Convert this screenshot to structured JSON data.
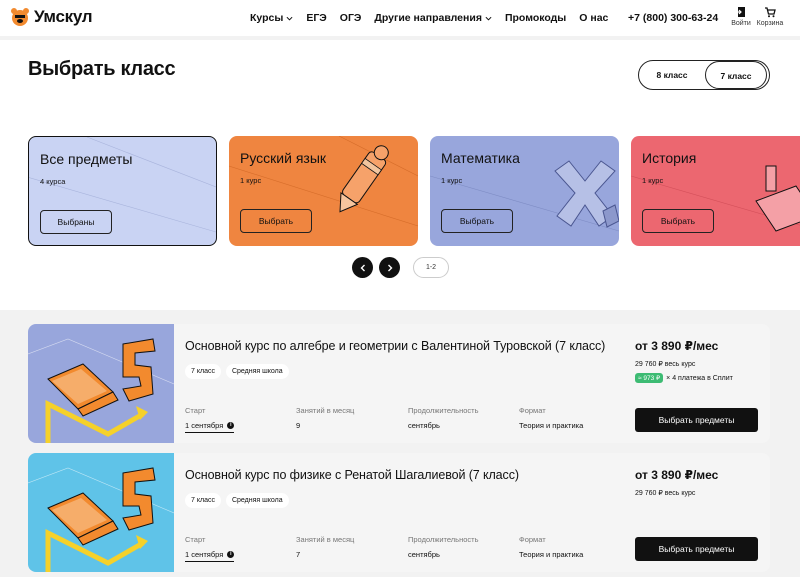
{
  "header": {
    "logo_text": "Умскул",
    "nav": [
      {
        "label": "Курсы",
        "dropdown": true
      },
      {
        "label": "ЕГЭ",
        "dropdown": false
      },
      {
        "label": "ОГЭ",
        "dropdown": false
      },
      {
        "label": "Другие направления",
        "dropdown": true
      },
      {
        "label": "Промокоды",
        "dropdown": false
      },
      {
        "label": "О нас",
        "dropdown": false
      }
    ],
    "phone": "+7 (800) 300-63-24",
    "login_label": "Войти",
    "cart_label": "Корзина"
  },
  "main": {
    "title": "Выбрать класс",
    "class_options": [
      "8 класс",
      "7 класс"
    ],
    "selected_class": "7 класс",
    "subjects": [
      {
        "title": "Все предметы",
        "count": "4 курса",
        "button": "Выбраны",
        "color": "#c9d3f3",
        "selected": true
      },
      {
        "title": "Русский язык",
        "count": "1 курс",
        "button": "Выбрать",
        "color": "#ef8540",
        "selected": false
      },
      {
        "title": "Математика",
        "count": "1 курс",
        "button": "Выбрать",
        "color": "#98a6dc",
        "selected": false
      },
      {
        "title": "История",
        "count": "1 курс",
        "button": "Выбрать",
        "color": "#ec6770",
        "selected": false
      }
    ],
    "pager": {
      "label": "1-2"
    }
  },
  "courses": [
    {
      "title": "Основной курс по алгебре и геометрии с Валентиной Туровской (7 класс)",
      "tags": [
        "7 класс",
        "Средняя школа"
      ],
      "meta": [
        {
          "label": "Старт",
          "value": "1 сентября"
        },
        {
          "label": "Занятий в месяц",
          "value": "9"
        },
        {
          "label": "Продолжительность",
          "value": "сентябрь"
        },
        {
          "label": "Формат",
          "value": "Теория и практика"
        }
      ],
      "price": "от 3 890 ₽/мес",
      "price_total": "29 760 ₽ весь курс",
      "split_badge": "≈ 973 ₽",
      "split_text": "× 4 платежа в Сплит",
      "button": "Выбрать предметы",
      "image_bg": "#98a6dc"
    },
    {
      "title": "Основной курс по физике с Ренатой Шагалиевой (7 класс)",
      "tags": [
        "7 класс",
        "Средняя школа"
      ],
      "meta": [
        {
          "label": "Старт",
          "value": "1 сентября"
        },
        {
          "label": "Занятий в месяц",
          "value": "7"
        },
        {
          "label": "Продолжительность",
          "value": "сентябрь"
        },
        {
          "label": "Формат",
          "value": "Теория и практика"
        }
      ],
      "price": "от 3 890 ₽/мес",
      "price_total": "29 760 ₽ весь курс",
      "button": "Выбрать предметы",
      "image_bg": "#5fc3e8"
    }
  ]
}
